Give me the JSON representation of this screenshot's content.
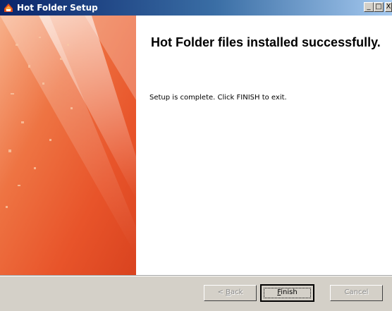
{
  "window": {
    "title": "Hot Folder Setup",
    "controls": {
      "minimize": "_",
      "maximize": "□",
      "close": "X"
    }
  },
  "main": {
    "headline": "Hot Folder files installed successfully.",
    "message": "Setup is complete. Click FINISH to exit."
  },
  "buttons": {
    "back": {
      "prefix": "< ",
      "accel": "B",
      "rest": "ack",
      "enabled": false
    },
    "finish": {
      "accel": "F",
      "rest": "inish",
      "enabled": true,
      "default": true
    },
    "cancel": {
      "label": "Cancel",
      "enabled": false
    }
  },
  "colors": {
    "titlebar_start": "#0a246a",
    "titlebar_end": "#a6caf0",
    "banner_orange": "#e8542a",
    "dialog_face": "#d4d0c8"
  },
  "icons": {
    "app": "hot-folder-app-icon",
    "minimize": "minimize-icon",
    "maximize": "maximize-icon",
    "close": "close-icon"
  }
}
